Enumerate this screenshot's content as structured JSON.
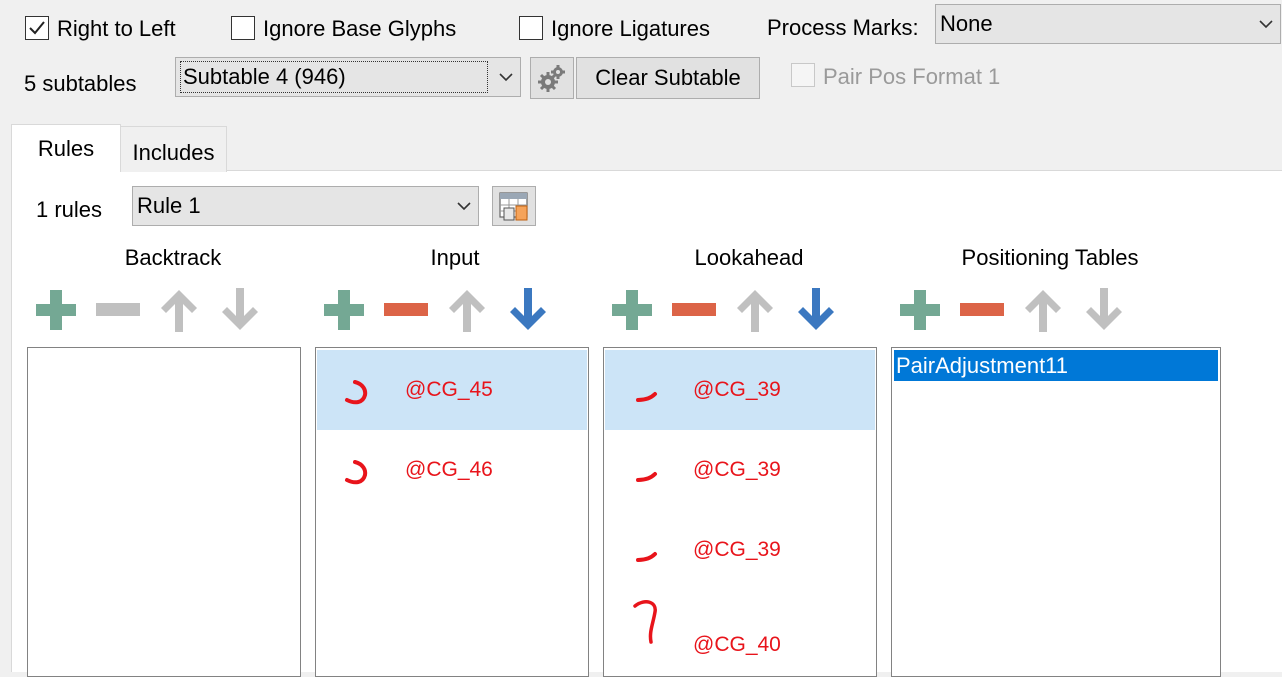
{
  "options": {
    "right_to_left": {
      "label": "Right to Left",
      "checked": true
    },
    "ignore_base_glyphs": {
      "label": "Ignore Base Glyphs",
      "checked": false
    },
    "ignore_ligatures": {
      "label": "Ignore Ligatures",
      "checked": false
    },
    "process_marks_label": "Process Marks:",
    "process_marks_value": "None"
  },
  "subtables": {
    "count_label": "5 subtables",
    "selected": "Subtable 4 (946)",
    "clear_label": "Clear Subtable",
    "pair_pos_format": {
      "label": "Pair Pos Format 1",
      "checked": false,
      "disabled": true
    }
  },
  "tabs": [
    {
      "label": "Rules",
      "active": true
    },
    {
      "label": "Includes",
      "active": false
    }
  ],
  "rules": {
    "count_label": "1 rules",
    "selected": "Rule 1"
  },
  "columns": {
    "backtrack": {
      "title": "Backtrack",
      "items": []
    },
    "input": {
      "title": "Input",
      "items": [
        {
          "label": "@CG_45",
          "selected": true
        },
        {
          "label": "@CG_46",
          "selected": false
        }
      ]
    },
    "lookahead": {
      "title": "Lookahead",
      "items": [
        {
          "label": "@CG_39",
          "selected": true
        },
        {
          "label": "@CG_39",
          "selected": false
        },
        {
          "label": "@CG_39",
          "selected": false
        },
        {
          "label": "@CG_40",
          "selected": false
        }
      ]
    },
    "positioning": {
      "title": "Positioning Tables",
      "items": [
        {
          "label": "PairAdjustment11",
          "selected": true
        }
      ]
    }
  },
  "colors": {
    "add": "#74a894",
    "remove": "#dc6447",
    "remove_disabled": "#c0c0c0",
    "arrow_disabled": "#c0c0c0",
    "arrow_active": "#3b78c0",
    "glyph_label": "#e8141b",
    "selection": "#cce4f7",
    "list_selection": "#0078d7"
  },
  "icons": {
    "settings": "gear-icon",
    "rule_editor": "table-edit-icon",
    "add": "plus-icon",
    "remove": "minus-icon",
    "move_up": "arrow-up-icon",
    "move_down": "arrow-down-icon"
  }
}
